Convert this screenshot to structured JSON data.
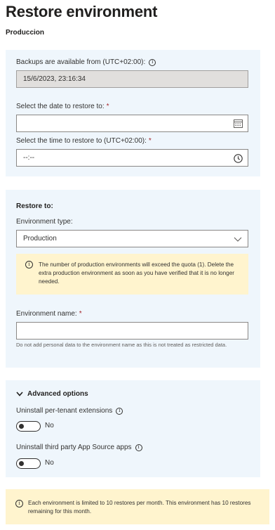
{
  "header": {
    "title": "Restore environment",
    "subtitle": "Produccion"
  },
  "backup_section": {
    "available_label": "Backups are available from (UTC+02:00):",
    "available_value": "15/6/2023, 23:16:34",
    "date_label": "Select the date to restore to:",
    "date_value": "",
    "time_label": "Select the time to restore to (UTC+02:00):",
    "time_placeholder": "--:--",
    "required_mark": "*"
  },
  "restore_to": {
    "heading": "Restore to:",
    "env_type_label": "Environment type:",
    "env_type_value": "Production",
    "warning": "The number of production environments will exceed the quota (1). Delete the extra production environment as soon as you have verified that it is no longer needed.",
    "env_name_label": "Environment name:",
    "env_name_value": "",
    "env_name_hint": "Do not add personal data to the environment name as this is not treated as restricted data."
  },
  "advanced": {
    "heading": "Advanced options",
    "toggles": [
      {
        "label": "Uninstall per-tenant extensions",
        "state": "No"
      },
      {
        "label": "Uninstall third party App Source apps",
        "state": "No"
      }
    ]
  },
  "footer": {
    "notice": "Each environment is limited to 10 restores per month. This environment has 10 restores remaining for this month."
  },
  "icons": {
    "info": "info-icon",
    "calendar": "calendar-icon",
    "clock": "clock-icon",
    "chevron": "chevron-down-icon"
  },
  "colors": {
    "panel_bg": "#eff6fc",
    "warning_bg": "#fff4ce",
    "required": "#a4262c",
    "readonly_bg": "#e1dfdd"
  }
}
